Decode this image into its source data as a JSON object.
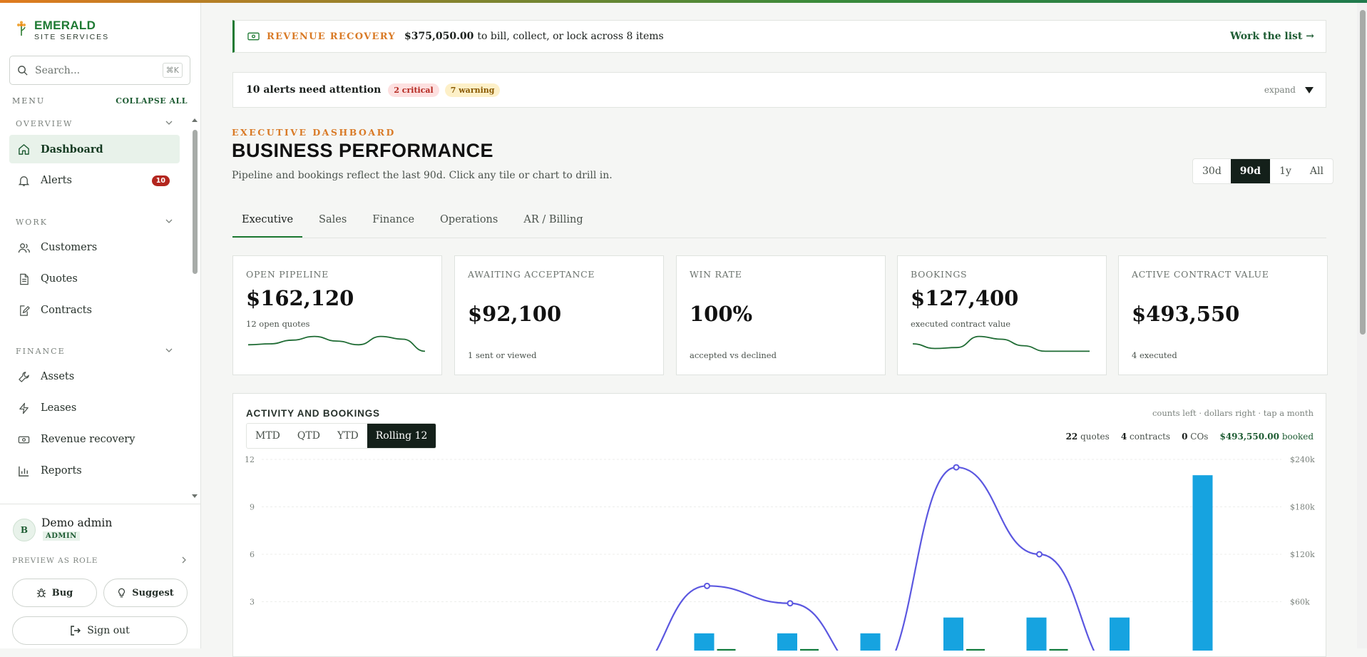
{
  "brand": {
    "name": "EMERALD",
    "subtitle": "SITE SERVICES"
  },
  "search": {
    "placeholder": "Search...",
    "shortcut": "⌘K"
  },
  "menu": {
    "label": "MENU",
    "collapse_label": "COLLAPSE ALL"
  },
  "sidebar": {
    "sections": [
      {
        "label": "OVERVIEW",
        "items": [
          {
            "label": "Dashboard",
            "icon": "home-icon",
            "active": true
          },
          {
            "label": "Alerts",
            "icon": "bell-icon",
            "badge": "10"
          }
        ]
      },
      {
        "label": "WORK",
        "items": [
          {
            "label": "Customers",
            "icon": "users-icon"
          },
          {
            "label": "Quotes",
            "icon": "file-icon"
          },
          {
            "label": "Contracts",
            "icon": "pen-file-icon"
          }
        ]
      },
      {
        "label": "FINANCE",
        "items": [
          {
            "label": "Assets",
            "icon": "wrench-icon"
          },
          {
            "label": "Leases",
            "icon": "bolt-icon"
          },
          {
            "label": "Revenue recovery",
            "icon": "cash-icon"
          },
          {
            "label": "Reports",
            "icon": "bar-chart-icon"
          }
        ]
      }
    ]
  },
  "user": {
    "initial": "B",
    "name": "Demo admin",
    "role": "ADMIN",
    "preview_label": "PREVIEW AS ROLE",
    "bug_label": "Bug",
    "suggest_label": "Suggest",
    "signout_label": "Sign out"
  },
  "banner": {
    "tag": "REVENUE RECOVERY",
    "amount": "$375,050.00",
    "text": "to bill, collect, or lock across 8 items",
    "link": "Work the list →"
  },
  "alerts": {
    "title": "10 alerts need attention",
    "critical": "2 critical",
    "warning": "7 warning",
    "expand": "expand"
  },
  "page": {
    "eyebrow": "EXECUTIVE DASHBOARD",
    "title": "BUSINESS PERFORMANCE",
    "subtitle": "Pipeline and bookings reflect the last 90d. Click any tile or chart to drill in."
  },
  "ranges": [
    {
      "label": "30d"
    },
    {
      "label": "90d",
      "active": true
    },
    {
      "label": "1y"
    },
    {
      "label": "All"
    }
  ],
  "tabs": [
    {
      "label": "Executive",
      "active": true
    },
    {
      "label": "Sales"
    },
    {
      "label": "Finance"
    },
    {
      "label": "Operations"
    },
    {
      "label": "AR / Billing"
    }
  ],
  "kpis": [
    {
      "label": "OPEN PIPELINE",
      "value": "$162,120",
      "note": "12 open quotes",
      "spark": [
        0.55,
        0.5,
        0.3,
        0.1,
        0.35,
        0.55,
        0.1,
        0.25,
        0.9
      ]
    },
    {
      "label": "AWAITING ACCEPTANCE",
      "value": "$92,100",
      "note": "1 sent or viewed"
    },
    {
      "label": "WIN RATE",
      "value": "100%",
      "note": "accepted vs declined"
    },
    {
      "label": "BOOKINGS",
      "value": "$127,400",
      "note": "executed contract value",
      "spark": [
        0.5,
        0.75,
        0.7,
        0.1,
        0.25,
        0.6,
        0.9,
        0.9,
        0.9
      ]
    },
    {
      "label": "ACTIVE CONTRACT VALUE",
      "value": "$493,550",
      "note": "4 executed"
    }
  ],
  "activity": {
    "title": "ACTIVITY AND BOOKINGS",
    "hint": "counts left · dollars right · tap a month",
    "periods": [
      {
        "label": "MTD"
      },
      {
        "label": "QTD"
      },
      {
        "label": "YTD"
      },
      {
        "label": "Rolling 12",
        "active": true
      }
    ],
    "stats": {
      "quotes_n": "22",
      "quotes_l": "quotes",
      "contracts_n": "4",
      "contracts_l": "contracts",
      "cos_n": "0",
      "cos_l": "COs",
      "booked_v": "$493,550.00",
      "booked_l": "booked"
    }
  },
  "chart_data": {
    "type": "bar",
    "title": "ACTIVITY AND BOOKINGS",
    "left_ticks": [
      "12",
      "9",
      "6",
      "3"
    ],
    "right_ticks": [
      "$240k",
      "$180k",
      "$120k",
      "$60k"
    ],
    "ylim_left": [
      0,
      12
    ],
    "ylim_right": [
      0,
      240000
    ],
    "series": [
      {
        "type": "bar",
        "color": "#16a3e0",
        "values": [
          0,
          0,
          0,
          0,
          0,
          1,
          1,
          1,
          2,
          2,
          2,
          11
        ]
      },
      {
        "type": "bar",
        "color": "#0e7a3a",
        "values": [
          0,
          0,
          0,
          0,
          0,
          1,
          1,
          0,
          1,
          1,
          0,
          0
        ]
      },
      {
        "type": "line",
        "color": "#5b57e0",
        "values": [
          0,
          0,
          0,
          0,
          0,
          80000,
          58000,
          0,
          230000,
          120000,
          0,
          0
        ]
      }
    ]
  }
}
